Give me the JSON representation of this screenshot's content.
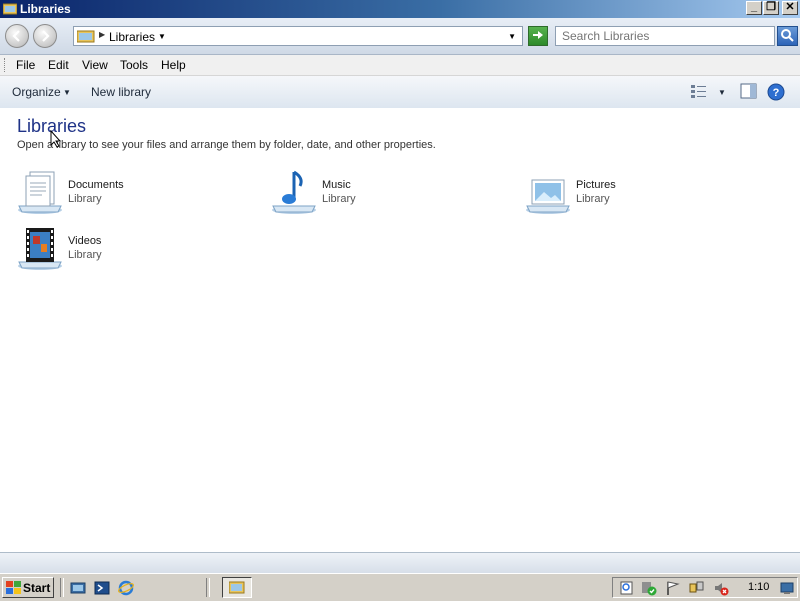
{
  "window": {
    "title": "Libraries"
  },
  "address": {
    "breadcrumb": "Libraries",
    "search_placeholder": "Search Libraries"
  },
  "menu": [
    "File",
    "Edit",
    "View",
    "Tools",
    "Help"
  ],
  "commands": {
    "organize": "Organize",
    "new_library": "New library"
  },
  "content": {
    "title": "Libraries",
    "subtitle": "Open a library to see your files and arrange them by folder, date, and other properties.",
    "libraries": [
      {
        "name": "Documents",
        "kind": "Library",
        "icon": "documents-library-icon"
      },
      {
        "name": "Music",
        "kind": "Library",
        "icon": "music-library-icon"
      },
      {
        "name": "Pictures",
        "kind": "Library",
        "icon": "pictures-library-icon"
      },
      {
        "name": "Videos",
        "kind": "Library",
        "icon": "videos-library-icon"
      }
    ]
  },
  "taskbar": {
    "start_label": "Start",
    "clock": "1:10"
  },
  "colors": {
    "title_bar_start": "#0a246a",
    "title_bar_end": "#a6caf0",
    "heading": "#1e3287"
  }
}
